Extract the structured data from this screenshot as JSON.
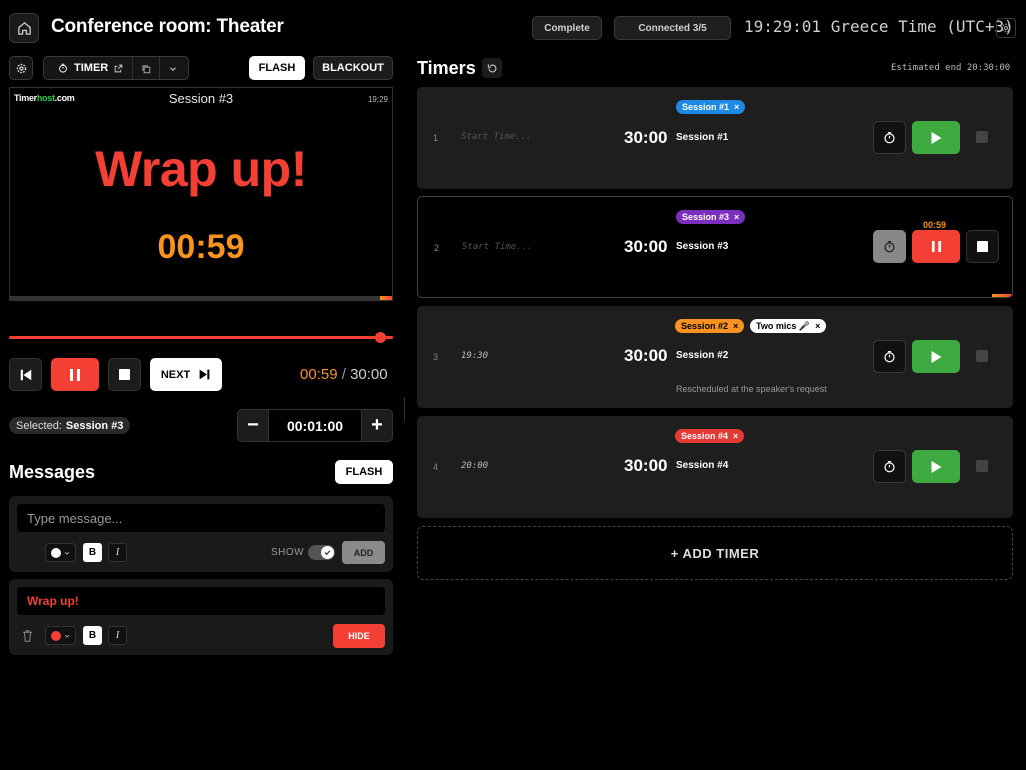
{
  "header": {
    "title": "Conference room: Theater",
    "complete_label": "Complete",
    "connected_label": "Connected 3/5",
    "clock": "19:29:01 Greece Time (UTC+3)"
  },
  "toolbar": {
    "timer_label": "TIMER",
    "flash_label": "FLASH",
    "blackout_label": "BLACKOUT"
  },
  "preview": {
    "logo_main": "Timer",
    "logo_green": "host",
    "logo_suffix": ".com",
    "title": "Session #3",
    "time": "19:29",
    "message": "Wrap up!",
    "countdown": "00:59",
    "message_color": "#f43f35",
    "countdown_color": "#f7931e"
  },
  "transport": {
    "next_label": "NEXT",
    "elapsed": "00:59",
    "separator": "/",
    "total": "30:00",
    "progress": 0.97
  },
  "selection": {
    "prefix": "Selected:",
    "name": "Session #3",
    "adjust_value": "00:01:00",
    "minus": "−",
    "plus": "+"
  },
  "messages": {
    "title": "Messages",
    "flash_label": "FLASH",
    "input_placeholder": "Type message...",
    "show_label": "SHOW",
    "add_label": "ADD",
    "items": [
      {
        "text": "Wrap up!",
        "color": "#f43f35",
        "hide_label": "HIDE"
      }
    ]
  },
  "timers": {
    "title": "Timers",
    "estimated_end": "Estimated end 20:30:00",
    "add_label": "+ ADD TIMER",
    "rows": [
      {
        "index": "1",
        "start": "Start Time...",
        "start_placeholder": true,
        "duration": "30:00",
        "name": "Session #1",
        "tags": [
          {
            "label": "Session #1",
            "color": "#1e88e5",
            "text_color": "#ffffff"
          }
        ],
        "note": "",
        "state": "idle",
        "live": ""
      },
      {
        "index": "2",
        "start": "Start Time...",
        "start_placeholder": true,
        "duration": "30:00",
        "name": "Session #3",
        "tags": [
          {
            "label": "Session #3",
            "color": "#7b2fbe",
            "text_color": "#ffffff"
          }
        ],
        "note": "",
        "state": "running",
        "live": "00:59"
      },
      {
        "index": "3",
        "start": "19:30",
        "start_placeholder": false,
        "duration": "30:00",
        "name": "Session #2",
        "tags": [
          {
            "label": "Session #2",
            "color": "#f7931e",
            "text_color": "#000000"
          },
          {
            "label": "Two mics 🎤",
            "color": "#ffffff",
            "text_color": "#000000"
          }
        ],
        "note": "Rescheduled at the speaker's request",
        "state": "idle",
        "live": ""
      },
      {
        "index": "4",
        "start": "20:00",
        "start_placeholder": false,
        "duration": "30:00",
        "name": "Session #4",
        "tags": [
          {
            "label": "Session #4",
            "color": "#e53935",
            "text_color": "#ffffff"
          }
        ],
        "note": "",
        "state": "idle",
        "live": ""
      }
    ]
  },
  "colors": {
    "accent_red": "#f43f35",
    "accent_orange": "#f7931e",
    "play_green": "#3faa3f"
  }
}
